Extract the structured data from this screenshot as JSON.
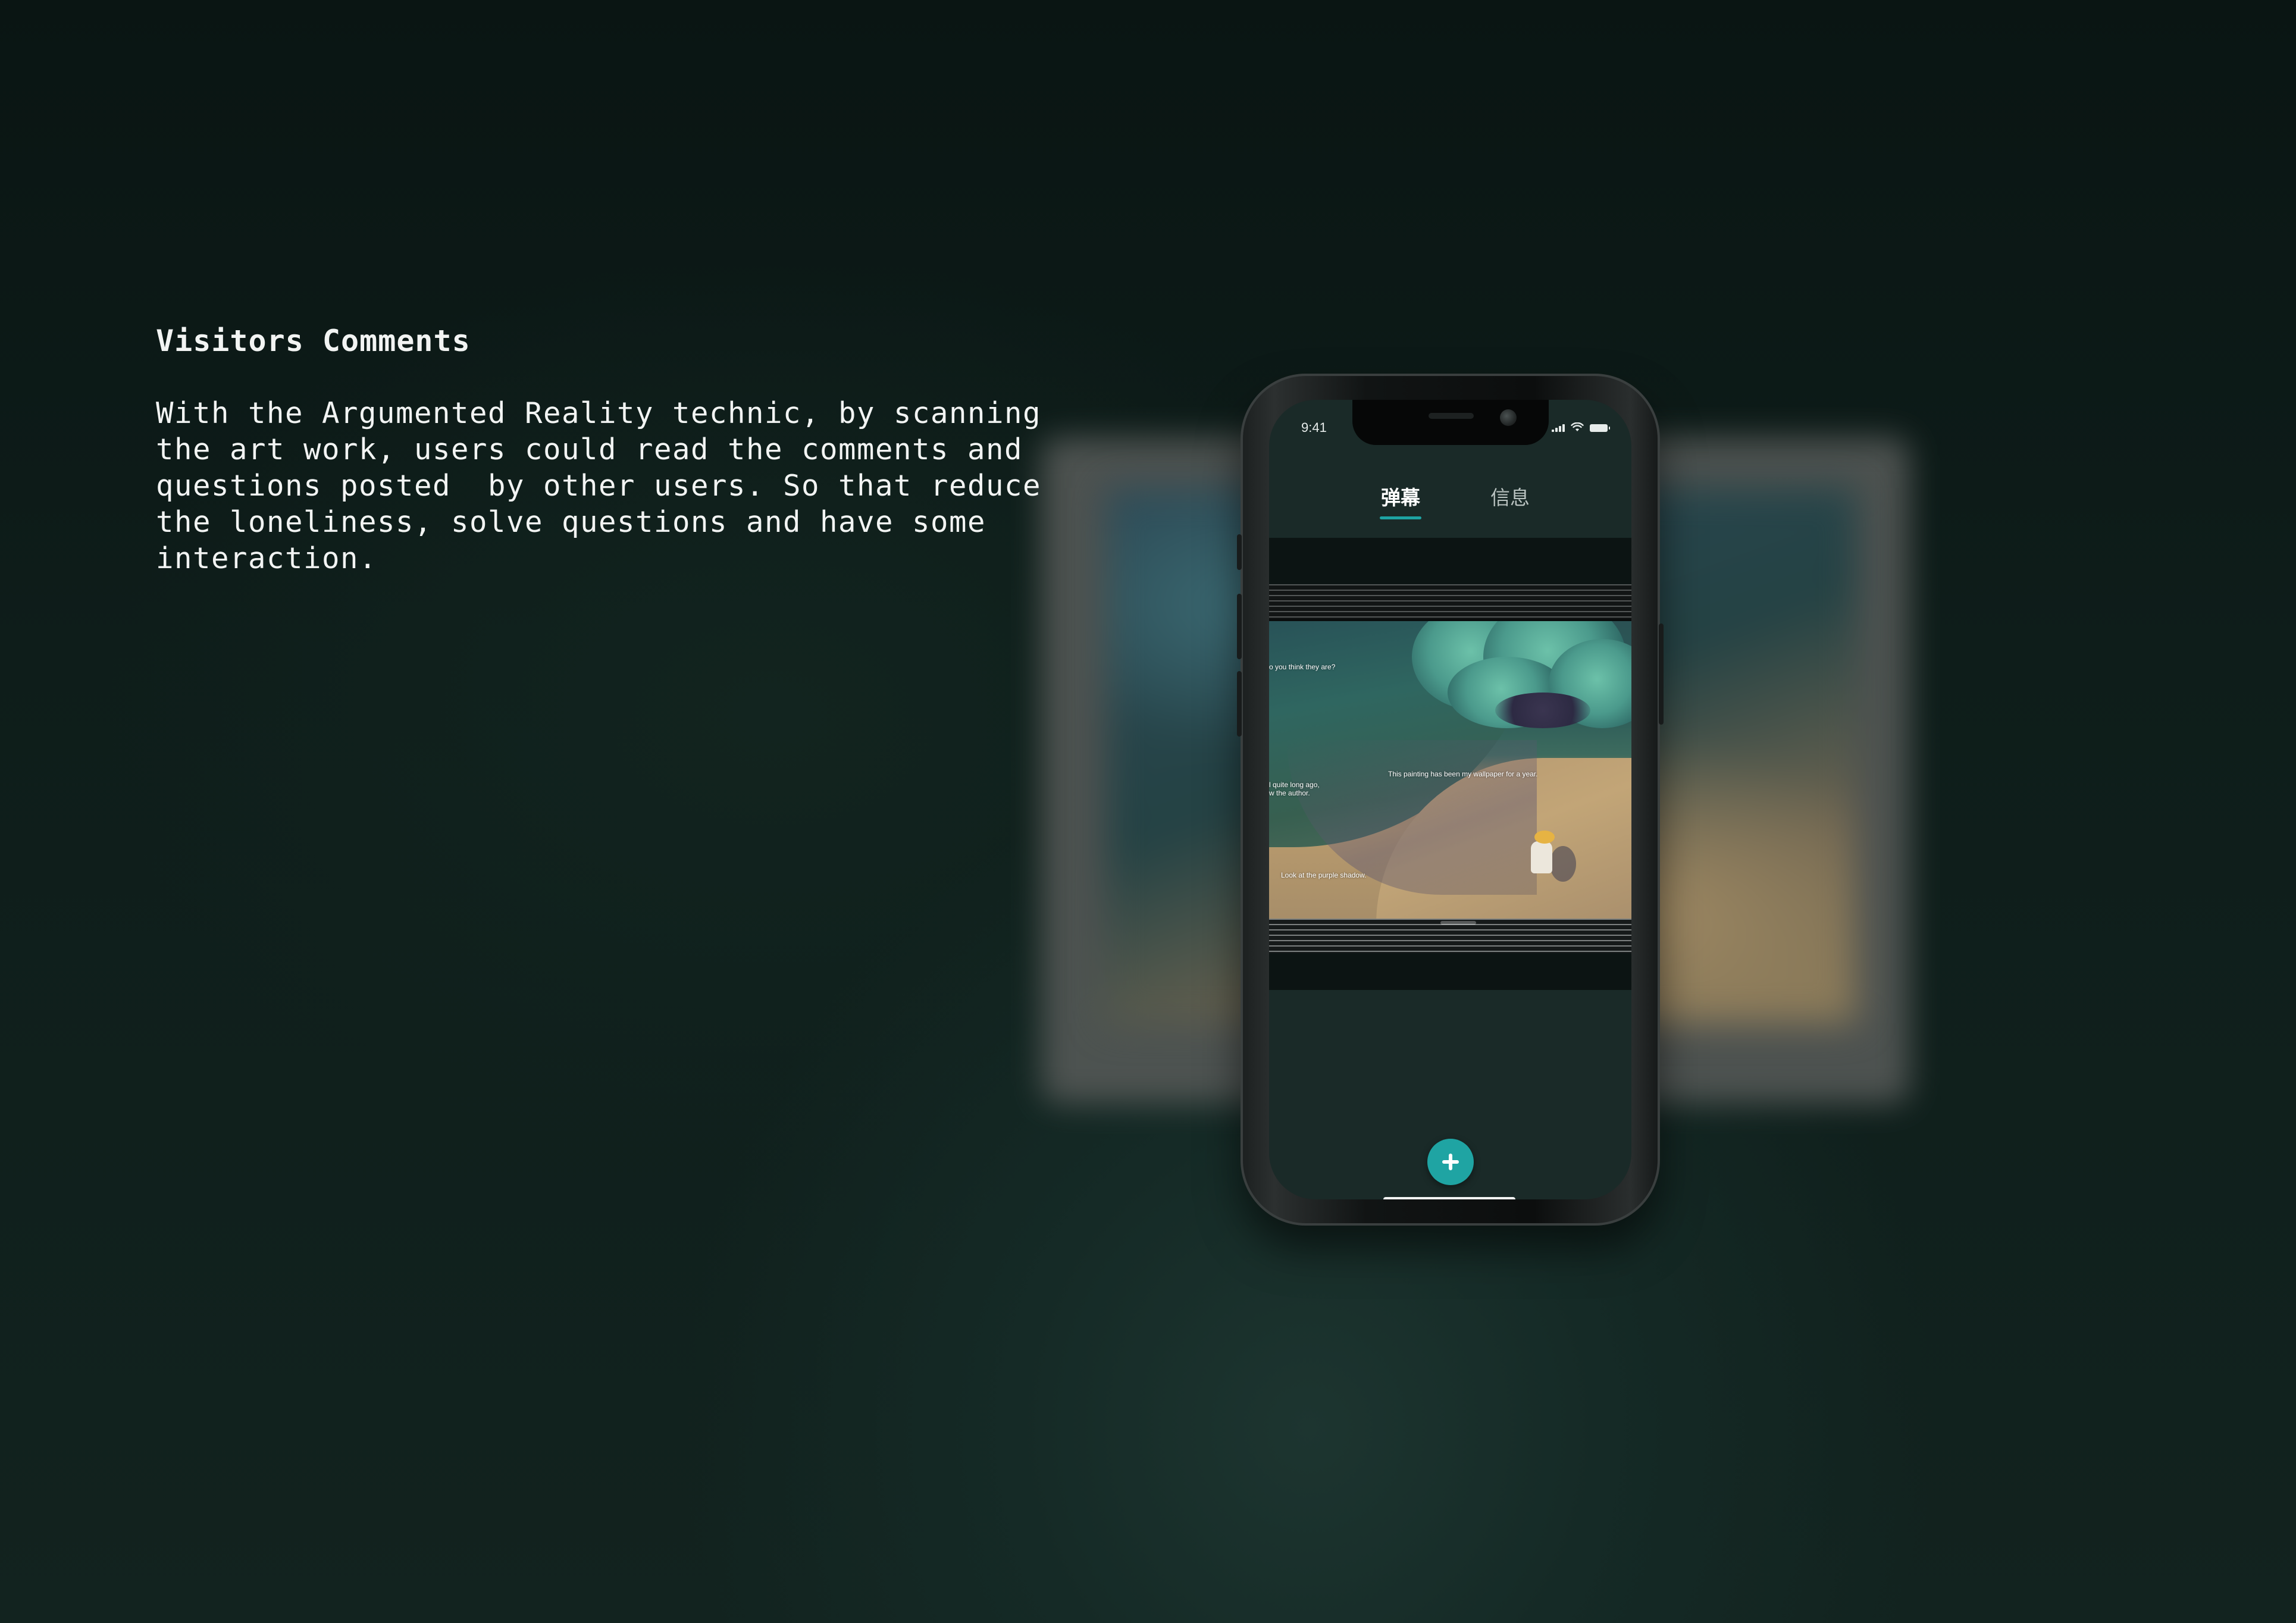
{
  "section": {
    "heading": "Visitors Comments",
    "description": "With the Argumented Reality technic, by scanning\nthe art work, users could read the comments and\nquestions posted  by other users. So that reduce\nthe loneliness, solve questions and have some\ninteraction."
  },
  "phone": {
    "status_bar": {
      "time": "9:41",
      "icons": [
        "signal-icon",
        "wifi-icon",
        "battery-icon"
      ]
    },
    "tabs": [
      {
        "label": "弹幕",
        "active": true
      },
      {
        "label": "信息",
        "active": false
      }
    ],
    "ar_comments": [
      {
        "text": "o you think they are?"
      },
      {
        "text": "This painting has been my wallpaper for a year."
      },
      {
        "line1": "l quite long ago,",
        "line2": "w the author."
      },
      {
        "text": "Look at the purple shadow."
      }
    ],
    "add_button_icon": "plus-icon"
  },
  "colors": {
    "background": "#0d1a18",
    "accent": "#1fa4a3",
    "text": "#f2f4f3"
  }
}
